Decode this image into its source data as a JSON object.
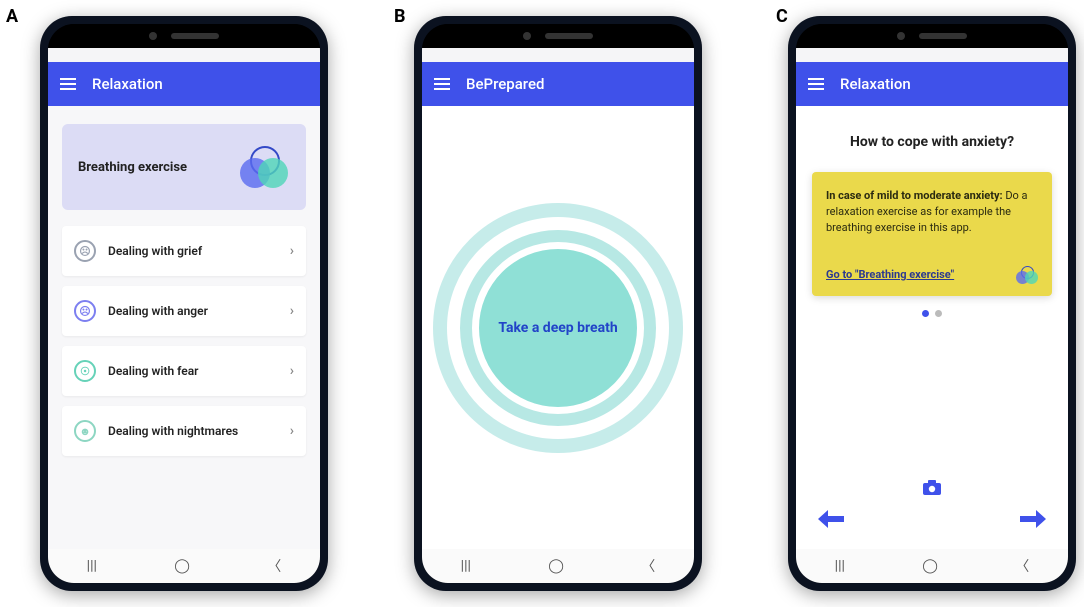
{
  "labels": {
    "a": "A",
    "b": "B",
    "c": "C"
  },
  "colors": {
    "primary": "#3f51ea",
    "hero_bg": "#dcdcf5",
    "card_yellow": "#ead94b",
    "ring_outer": "#c6ecea",
    "ring_mid": "#b7e8e4",
    "ring_core": "#8fe0d6"
  },
  "screenA": {
    "app_title": "Relaxation",
    "hero": {
      "title": "Breathing exercise",
      "icon": "venn-icon"
    },
    "items": [
      {
        "icon": "face-sad-icon",
        "icon_color": "#9aa2b1",
        "label": "Dealing with grief"
      },
      {
        "icon": "face-angry-icon",
        "icon_color": "#7c7ff0",
        "label": "Dealing with anger"
      },
      {
        "icon": "face-fear-icon",
        "icon_color": "#66d2b8",
        "label": "Dealing with fear"
      },
      {
        "icon": "face-tired-icon",
        "icon_color": "#8dd6c2",
        "label": "Dealing with nightmares"
      }
    ]
  },
  "screenB": {
    "app_title": "BePrepared",
    "instruction": "Take a deep breath"
  },
  "screenC": {
    "app_title": "Relaxation",
    "heading": "How to cope with anxiety?",
    "card": {
      "strong": "In case of mild to moderate anxiety:",
      "body": " Do a relaxation exercise as for example the breathing exercise in this app.",
      "link_text": "Go to \"Breathing exercise\""
    },
    "page_dots": {
      "count": 2,
      "active_index": 0
    },
    "camera_icon": "camera-icon",
    "nav": {
      "prev": "prev-arrow",
      "next": "next-arrow"
    }
  },
  "system_nav": {
    "recents": "|||",
    "home": "◯",
    "back": "〈"
  }
}
